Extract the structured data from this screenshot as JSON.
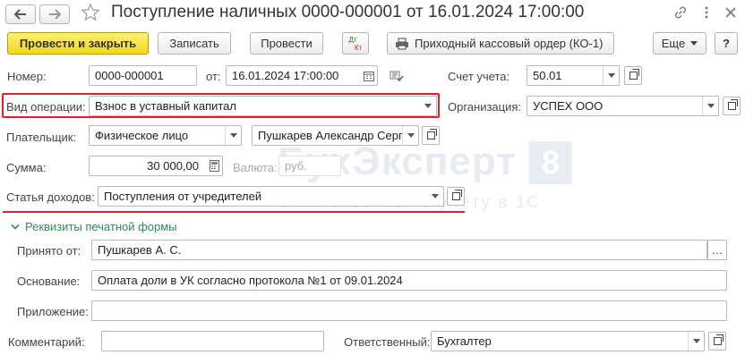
{
  "window": {
    "title": "Поступление наличных 0000-000001 от 16.01.2024 17:00:00"
  },
  "toolbar": {
    "post_close": "Провести и закрыть",
    "save": "Записать",
    "post": "Провести",
    "dtkt_top": "Дт",
    "dtkt_bottom": "Кт",
    "print_order": "Приходный кассовый ордер (КО-1)",
    "more": "Еще",
    "help": "?"
  },
  "form": {
    "number": {
      "label": "Номер:",
      "value": "0000-000001"
    },
    "date": {
      "label": "от:",
      "value": "16.01.2024 17:00:00"
    },
    "account": {
      "label": "Счет учета:",
      "value": "50.01"
    },
    "operation": {
      "label": "Вид операции:",
      "value": "Взнос в уставный капитал"
    },
    "organization": {
      "label": "Организация:",
      "value": "УСПЕХ ООО"
    },
    "payer": {
      "label": "Плательщик:",
      "type_value": "Физическое лицо",
      "value": "Пушкарев Александр Серг"
    },
    "amount": {
      "label": "Сумма:",
      "value": "30 000,00"
    },
    "currency": {
      "label": "Валюта:",
      "value": "руб."
    },
    "income_item": {
      "label": "Статья доходов:",
      "value": "Поступления от учредителей"
    }
  },
  "print_section": {
    "title": "Реквизиты печатной формы",
    "received_from": {
      "label": "Принято от:",
      "value": "Пушкарев А. С."
    },
    "basis": {
      "label": "Основание:",
      "value": "Оплата доли в УК согласно протокола №1 от 09.01.2024"
    },
    "attachment": {
      "label": "Приложение:",
      "value": ""
    }
  },
  "footer": {
    "comment": {
      "label": "Комментарий:",
      "value": ""
    },
    "responsible": {
      "label": "Ответственный:",
      "value": "Бухгалтер"
    }
  },
  "watermark": {
    "line1": "БухЭксперт",
    "badge": "8",
    "line2": "База ответов по учёту в 1С"
  },
  "colors": {
    "accent": "#f2d61e",
    "highlight": "#e0202c",
    "section": "#2e8b57"
  }
}
